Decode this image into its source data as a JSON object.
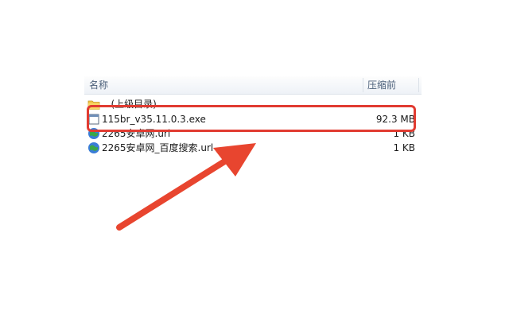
{
  "columns": {
    "name": "名称",
    "size": "压缩前"
  },
  "files": [
    {
      "name": ".. (上级目录)",
      "size": "",
      "icon": "folder-up-icon"
    },
    {
      "name": "115br_v35.11.0.3.exe",
      "size": "92.3 MB",
      "icon": "exe-file-icon"
    },
    {
      "name": "2265安卓网.url",
      "size": "1 KB",
      "icon": "url-globe-icon"
    },
    {
      "name": "2265安卓网_百度搜索.url",
      "size": "1 KB",
      "icon": "url-globe-icon"
    }
  ],
  "colors": {
    "highlight": "#e13b31",
    "arrow": "#e8452f",
    "header_text": "#4c607a"
  }
}
